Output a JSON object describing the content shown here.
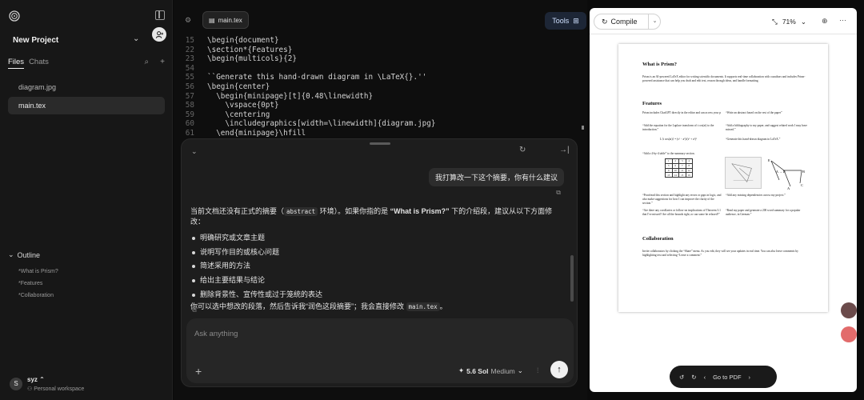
{
  "sidebar": {
    "project_name": "New Project",
    "tabs": {
      "files": "Files",
      "chats": "Chats"
    },
    "files": [
      {
        "name": "diagram.jpg",
        "active": false
      },
      {
        "name": "main.tex",
        "active": true
      }
    ],
    "outline_title": "Outline",
    "outline": [
      "*What is Prism?",
      "*Features",
      "*Collaboration"
    ],
    "user": {
      "initial": "S",
      "name": "syz",
      "workspace": "Personal workspace"
    }
  },
  "editor": {
    "file_tab": "main.tex",
    "tools_label": "Tools",
    "code": [
      {
        "n": "15",
        "t": "\\begin{document}"
      },
      {
        "n": "22",
        "t": "\\section*{Features}"
      },
      {
        "n": "23",
        "t": "\\begin{multicols}{2}"
      },
      {
        "n": "54",
        "t": ""
      },
      {
        "n": "55",
        "t": "``Generate this hand-drawn diagram in \\LaTeX{}.''"
      },
      {
        "n": "56",
        "t": "\\begin{center}"
      },
      {
        "n": "57",
        "t": "  \\begin{minipage}[t]{0.48\\linewidth}"
      },
      {
        "n": "58",
        "t": "    \\vspace{0pt}"
      },
      {
        "n": "59",
        "t": "    \\centering"
      },
      {
        "n": "60",
        "t": "    \\includegraphics[width=\\linewidth]{diagram.jpg}"
      },
      {
        "n": "61",
        "t": "  \\end{minipage}\\hfill"
      }
    ]
  },
  "chat": {
    "user_message": "我打算改一下这个摘要，你有什么建议",
    "assistant_intro_1": "当前文档还没有正式的摘要（",
    "assistant_code_1": "abstract",
    "assistant_intro_2": " 环境）。如果你指的是 ",
    "assistant_bold": "“What is Prism?”",
    "assistant_intro_3": " 下的介绍段，建议从以下方面修改：",
    "bullets": [
      "明确研究或文章主题",
      "说明写作目的或核心问题",
      "简述采用的方法",
      "给出主要结果与结论",
      "删除背景性、宣传性或过于笼统的表达"
    ],
    "closing_1": "你可以选中想改的段落，然后告诉我“润色这段摘要”；我会直接修改 ",
    "closing_code": "main.tex",
    "closing_2": "。",
    "placeholder": "Ask anything",
    "model": "5.6 Sol",
    "model_mode": "Medium"
  },
  "pdf": {
    "compile_label": "Compile",
    "zoom": "71%",
    "nav_label": "Go to PDF",
    "page": {
      "h1": "What is Prism?",
      "p1": "Prism is an AI-powered LaTeX editor for writing scientific documents. It supports real-time collaboration with coauthors and includes Prism-powered assistance that can help you draft and edit text, reason through ideas, and handle formatting.",
      "h2": "Features",
      "f_left_1": "Prism includes ChatGPT directly in the editor and can access your p",
      "f_left_2": "“Add the equation for the Laplace transform of t cos(at) to the introduction.”",
      "f_left_eq": "L{t cos(at)} = (s² − a²)/(s² + a²)²",
      "f_left_3": "“Add a 4-by-4 table” to the summary section.",
      "f_left_4": "“Proofread this section and highlight any errors or gaps in logic, and also make suggestions for how I can improve the clarity of the section.”",
      "f_left_5": "“Are there any corollaries or follow-on implications of Theorem 3.1 that I've missed? Are all the bounds tight, or can some be relaxed?”",
      "f_right_1": "“Write an abstract based on the rest of the paper”",
      "f_right_2": "“Add a bibliography to my paper, and suggest related work I may have missed.”",
      "f_right_3": "“Generate this hand-drawn diagram in LaTeX.”",
      "f_right_4": "“Add any missing dependencies across my project.”",
      "f_right_5": "“Read my paper and generate a 200 word summary for a popular audience, in German.”",
      "table": [
        [
          "1",
          "2",
          "3",
          "4"
        ],
        [
          "5",
          "6",
          "7",
          "8"
        ],
        [
          "9",
          "10",
          "11",
          "12"
        ],
        [
          "13",
          "14",
          "15",
          "16"
        ]
      ],
      "h3": "Collaboration",
      "p3": "Invite collaborators by clicking the “Share” menu. As you edit, they will see your updates in real time. You can also leave comments by highlighting text and selecting “Leave a comment.”",
      "diagram_labels": {
        "a": "A",
        "b": "B",
        "c": "C",
        "e": "E",
        "arrow": "A → D"
      }
    }
  }
}
